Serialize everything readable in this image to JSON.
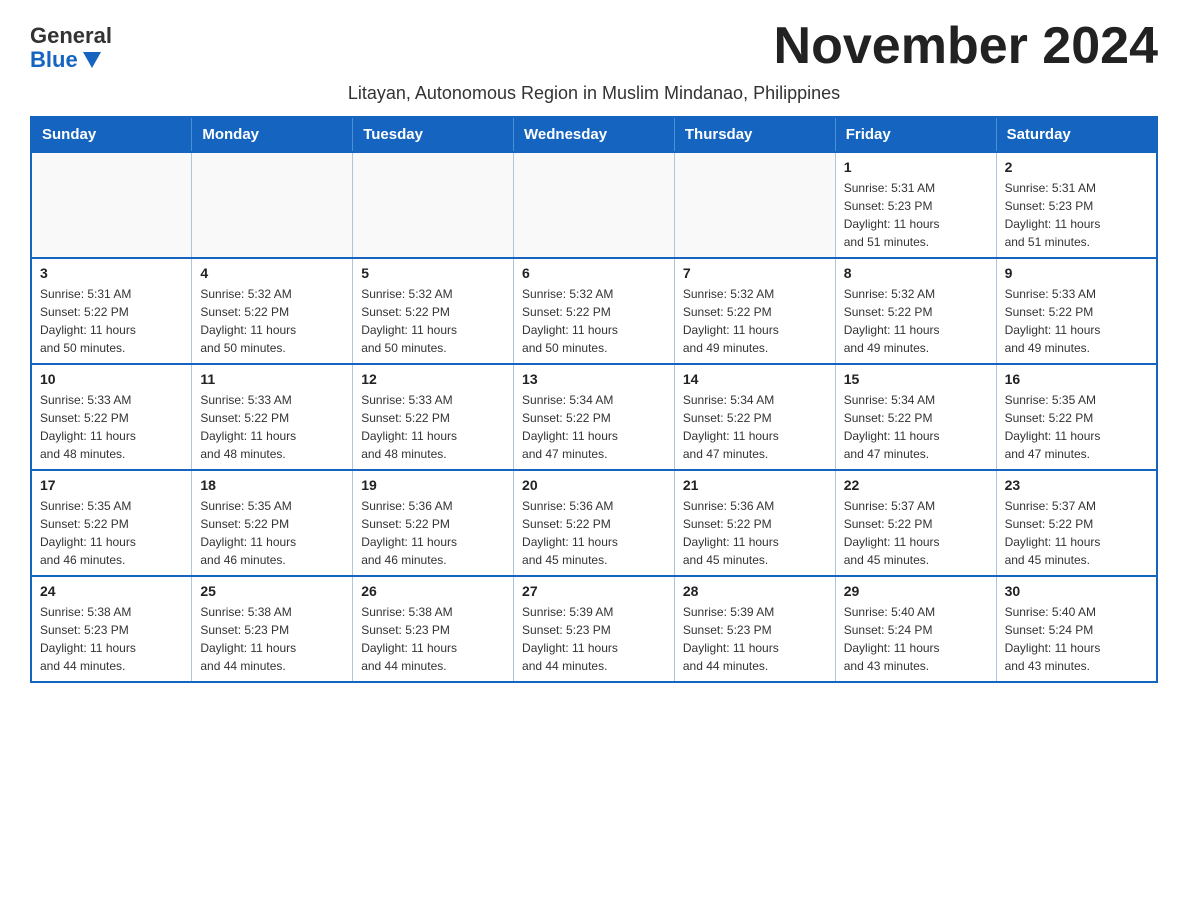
{
  "logo": {
    "general": "General",
    "blue": "Blue"
  },
  "title": "November 2024",
  "subtitle": "Litayan, Autonomous Region in Muslim Mindanao, Philippines",
  "headers": [
    "Sunday",
    "Monday",
    "Tuesday",
    "Wednesday",
    "Thursday",
    "Friday",
    "Saturday"
  ],
  "weeks": [
    [
      {
        "day": "",
        "info": ""
      },
      {
        "day": "",
        "info": ""
      },
      {
        "day": "",
        "info": ""
      },
      {
        "day": "",
        "info": ""
      },
      {
        "day": "",
        "info": ""
      },
      {
        "day": "1",
        "info": "Sunrise: 5:31 AM\nSunset: 5:23 PM\nDaylight: 11 hours\nand 51 minutes."
      },
      {
        "day": "2",
        "info": "Sunrise: 5:31 AM\nSunset: 5:23 PM\nDaylight: 11 hours\nand 51 minutes."
      }
    ],
    [
      {
        "day": "3",
        "info": "Sunrise: 5:31 AM\nSunset: 5:22 PM\nDaylight: 11 hours\nand 50 minutes."
      },
      {
        "day": "4",
        "info": "Sunrise: 5:32 AM\nSunset: 5:22 PM\nDaylight: 11 hours\nand 50 minutes."
      },
      {
        "day": "5",
        "info": "Sunrise: 5:32 AM\nSunset: 5:22 PM\nDaylight: 11 hours\nand 50 minutes."
      },
      {
        "day": "6",
        "info": "Sunrise: 5:32 AM\nSunset: 5:22 PM\nDaylight: 11 hours\nand 50 minutes."
      },
      {
        "day": "7",
        "info": "Sunrise: 5:32 AM\nSunset: 5:22 PM\nDaylight: 11 hours\nand 49 minutes."
      },
      {
        "day": "8",
        "info": "Sunrise: 5:32 AM\nSunset: 5:22 PM\nDaylight: 11 hours\nand 49 minutes."
      },
      {
        "day": "9",
        "info": "Sunrise: 5:33 AM\nSunset: 5:22 PM\nDaylight: 11 hours\nand 49 minutes."
      }
    ],
    [
      {
        "day": "10",
        "info": "Sunrise: 5:33 AM\nSunset: 5:22 PM\nDaylight: 11 hours\nand 48 minutes."
      },
      {
        "day": "11",
        "info": "Sunrise: 5:33 AM\nSunset: 5:22 PM\nDaylight: 11 hours\nand 48 minutes."
      },
      {
        "day": "12",
        "info": "Sunrise: 5:33 AM\nSunset: 5:22 PM\nDaylight: 11 hours\nand 48 minutes."
      },
      {
        "day": "13",
        "info": "Sunrise: 5:34 AM\nSunset: 5:22 PM\nDaylight: 11 hours\nand 47 minutes."
      },
      {
        "day": "14",
        "info": "Sunrise: 5:34 AM\nSunset: 5:22 PM\nDaylight: 11 hours\nand 47 minutes."
      },
      {
        "day": "15",
        "info": "Sunrise: 5:34 AM\nSunset: 5:22 PM\nDaylight: 11 hours\nand 47 minutes."
      },
      {
        "day": "16",
        "info": "Sunrise: 5:35 AM\nSunset: 5:22 PM\nDaylight: 11 hours\nand 47 minutes."
      }
    ],
    [
      {
        "day": "17",
        "info": "Sunrise: 5:35 AM\nSunset: 5:22 PM\nDaylight: 11 hours\nand 46 minutes."
      },
      {
        "day": "18",
        "info": "Sunrise: 5:35 AM\nSunset: 5:22 PM\nDaylight: 11 hours\nand 46 minutes."
      },
      {
        "day": "19",
        "info": "Sunrise: 5:36 AM\nSunset: 5:22 PM\nDaylight: 11 hours\nand 46 minutes."
      },
      {
        "day": "20",
        "info": "Sunrise: 5:36 AM\nSunset: 5:22 PM\nDaylight: 11 hours\nand 45 minutes."
      },
      {
        "day": "21",
        "info": "Sunrise: 5:36 AM\nSunset: 5:22 PM\nDaylight: 11 hours\nand 45 minutes."
      },
      {
        "day": "22",
        "info": "Sunrise: 5:37 AM\nSunset: 5:22 PM\nDaylight: 11 hours\nand 45 minutes."
      },
      {
        "day": "23",
        "info": "Sunrise: 5:37 AM\nSunset: 5:22 PM\nDaylight: 11 hours\nand 45 minutes."
      }
    ],
    [
      {
        "day": "24",
        "info": "Sunrise: 5:38 AM\nSunset: 5:23 PM\nDaylight: 11 hours\nand 44 minutes."
      },
      {
        "day": "25",
        "info": "Sunrise: 5:38 AM\nSunset: 5:23 PM\nDaylight: 11 hours\nand 44 minutes."
      },
      {
        "day": "26",
        "info": "Sunrise: 5:38 AM\nSunset: 5:23 PM\nDaylight: 11 hours\nand 44 minutes."
      },
      {
        "day": "27",
        "info": "Sunrise: 5:39 AM\nSunset: 5:23 PM\nDaylight: 11 hours\nand 44 minutes."
      },
      {
        "day": "28",
        "info": "Sunrise: 5:39 AM\nSunset: 5:23 PM\nDaylight: 11 hours\nand 44 minutes."
      },
      {
        "day": "29",
        "info": "Sunrise: 5:40 AM\nSunset: 5:24 PM\nDaylight: 11 hours\nand 43 minutes."
      },
      {
        "day": "30",
        "info": "Sunrise: 5:40 AM\nSunset: 5:24 PM\nDaylight: 11 hours\nand 43 minutes."
      }
    ]
  ]
}
